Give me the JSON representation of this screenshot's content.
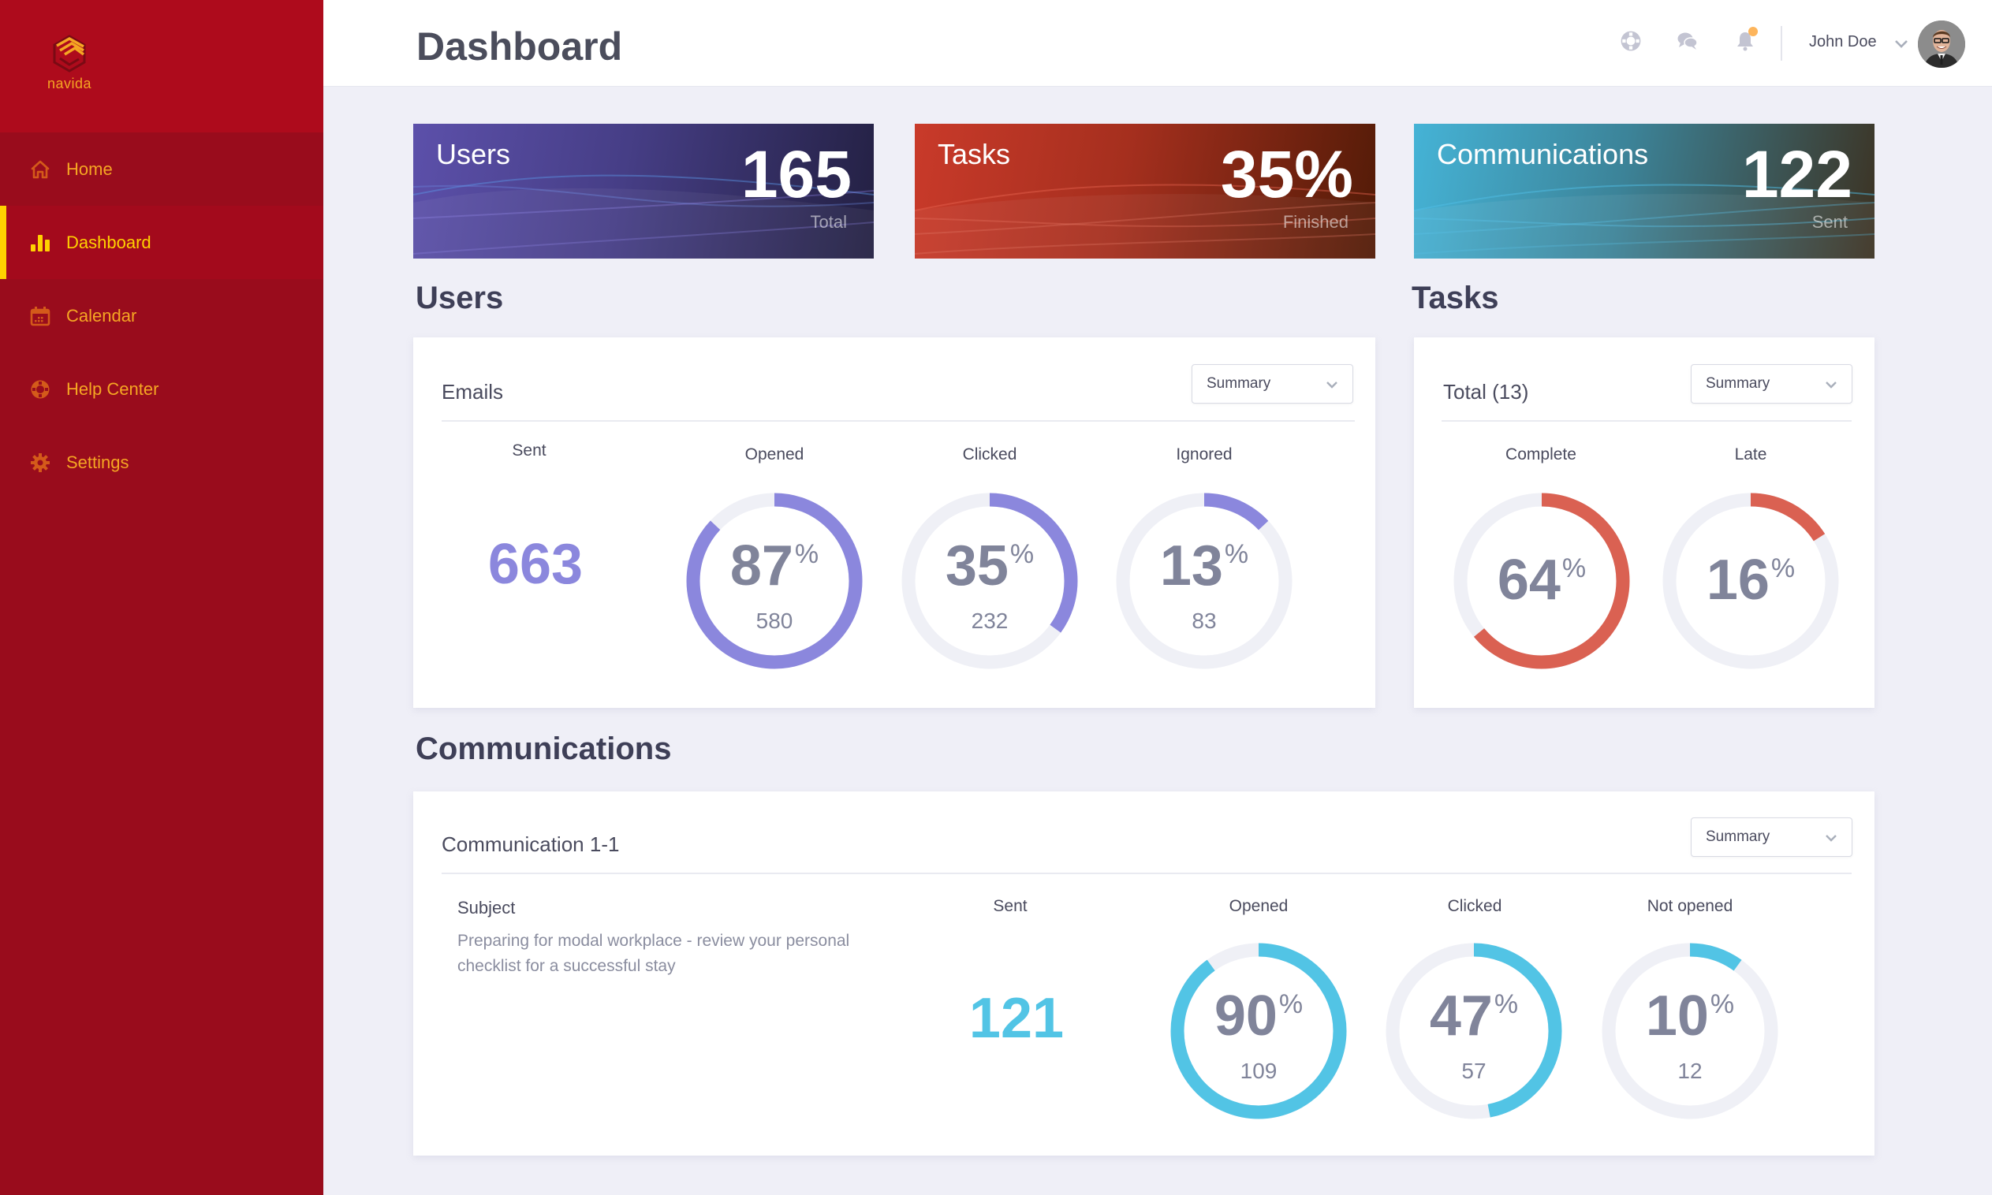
{
  "brand": {
    "name": "navida",
    "logo_icon": "hexagon-logo-icon"
  },
  "sidebar": {
    "items": [
      {
        "label": "Home",
        "icon": "home-icon",
        "active": false
      },
      {
        "label": "Dashboard",
        "icon": "bar-chart-icon",
        "active": true
      },
      {
        "label": "Calendar",
        "icon": "calendar-icon",
        "active": false
      },
      {
        "label": "Help Center",
        "icon": "lifebuoy-icon",
        "active": false
      },
      {
        "label": "Settings",
        "icon": "gear-icon",
        "active": false
      }
    ]
  },
  "header": {
    "title": "Dashboard",
    "icons": [
      "lifebuoy-icon",
      "chat-icon",
      "bell-icon"
    ],
    "notification_dot": true,
    "user_name": "John Doe"
  },
  "stat_cards": [
    {
      "title": "Users",
      "value": "165",
      "sub": "Total"
    },
    {
      "title": "Tasks",
      "value": "35%",
      "sub": "Finished"
    },
    {
      "title": "Communications",
      "value": "122",
      "sub": "Sent"
    }
  ],
  "colors": {
    "sidebar_bg": "#990C1C",
    "accent_yellow": "#FFD200",
    "nav_text": "#F5A623",
    "users_accent": "#8B87DD",
    "tasks_accent": "#DA6152",
    "comms_accent": "#52C4E5",
    "donut_track": "#EFF0F6"
  },
  "users_section": {
    "title": "Users",
    "panel_title": "Emails",
    "select_value": "Summary",
    "sent": {
      "label": "Sent",
      "value": "663"
    },
    "metrics": [
      {
        "label": "Opened",
        "percent": 87,
        "count": "580"
      },
      {
        "label": "Clicked",
        "percent": 35,
        "count": "232"
      },
      {
        "label": "Ignored",
        "percent": 13,
        "count": "83"
      }
    ]
  },
  "tasks_section": {
    "title": "Tasks",
    "panel_title": "Total (13)",
    "select_value": "Summary",
    "metrics": [
      {
        "label": "Complete",
        "percent": 64
      },
      {
        "label": "Late",
        "percent": 16
      }
    ]
  },
  "communications_section": {
    "title": "Communications",
    "panel_title": "Communication 1-1",
    "select_value": "Summary",
    "subject_label": "Subject",
    "subject_text": "Preparing for modal workplace - review your  personal checklist for a successful stay",
    "sent": {
      "label": "Sent",
      "value": "121"
    },
    "metrics": [
      {
        "label": "Opened",
        "percent": 90,
        "count": "109"
      },
      {
        "label": "Clicked",
        "percent": 47,
        "count": "57"
      },
      {
        "label": "Not opened",
        "percent": 10,
        "count": "12"
      }
    ]
  },
  "percent_sign": "%"
}
